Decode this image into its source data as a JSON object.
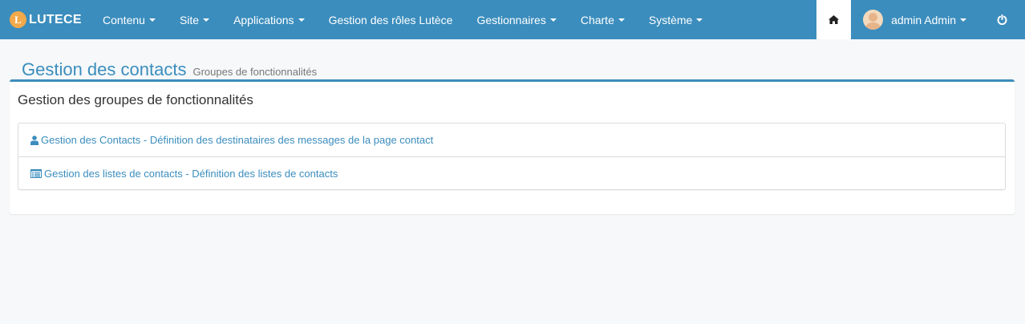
{
  "navbar": {
    "brand_initial": "L",
    "brand_name": "LUTECE",
    "menus": [
      {
        "label": "Contenu",
        "dropdown": true
      },
      {
        "label": "Site",
        "dropdown": true
      },
      {
        "label": "Applications",
        "dropdown": true
      },
      {
        "label": "Gestion des rôles Lutèce",
        "dropdown": false
      },
      {
        "label": "Gestionnaires",
        "dropdown": true
      },
      {
        "label": "Charte",
        "dropdown": true
      },
      {
        "label": "Système",
        "dropdown": true
      }
    ],
    "user_name": "admin Admin",
    "icons": {
      "home": "home-icon",
      "power": "power-icon"
    }
  },
  "header": {
    "title": "Gestion des contacts",
    "subtitle": "Groupes de fonctionnalités"
  },
  "box": {
    "title": "Gestion des groupes de fonctionnalités",
    "items": [
      {
        "icon": "user-icon",
        "label": "Gestion des Contacts - Définition des destinataires des messages de la page contact"
      },
      {
        "icon": "list-alt-icon",
        "label": "Gestion des listes de contacts - Définition des listes de contacts"
      }
    ]
  },
  "colors": {
    "navbar_bg": "#3b8dbd",
    "link": "#3b8dbd",
    "page_bg": "#f6f8fa",
    "logo": "#f2a94a"
  }
}
